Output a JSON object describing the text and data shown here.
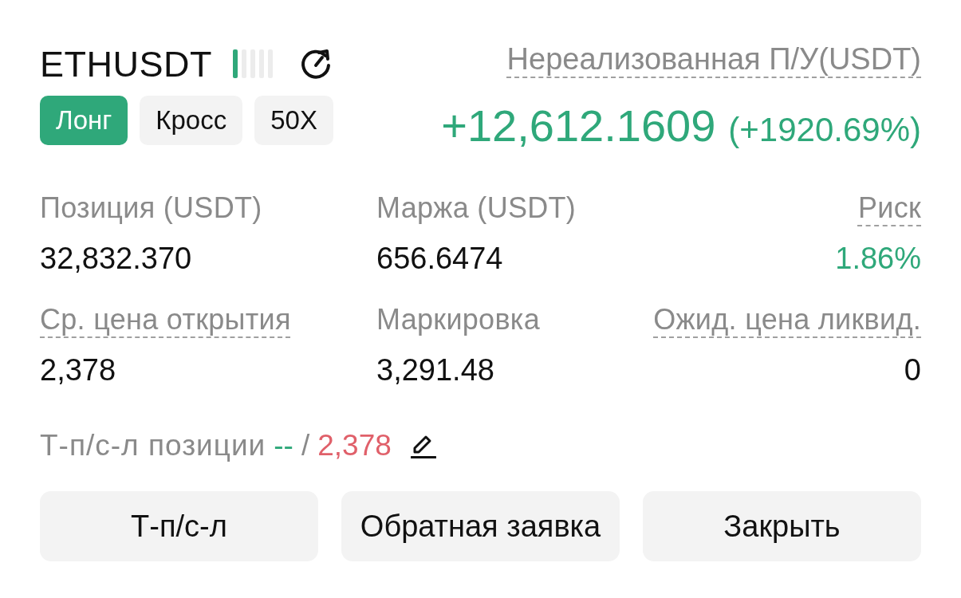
{
  "header": {
    "symbol": "ETHUSDT",
    "risk_meter": {
      "level": 0.2
    },
    "tags": [
      {
        "label": "Лонг",
        "kind": "side"
      },
      {
        "label": "Кросс",
        "kind": "plain"
      },
      {
        "label": "50X",
        "kind": "plain"
      }
    ]
  },
  "pnl": {
    "label": "Нереализованная П/У(USDT)",
    "underlined": true,
    "value": "+12,612.1609",
    "percent": "(+1920.69%)"
  },
  "stats": [
    {
      "label": "Позиция (USDT)",
      "underlined": false,
      "value": "32,832.370",
      "positive": false
    },
    {
      "label": "Маржа (USDT)",
      "underlined": false,
      "value": "656.6474",
      "positive": false
    },
    {
      "label": "Риск",
      "underlined": true,
      "value": "1.86%",
      "positive": true
    },
    {
      "label": "Ср. цена открытия",
      "underlined": true,
      "value": "2,378",
      "positive": false
    },
    {
      "label": "Маркировка",
      "underlined": false,
      "value": "3,291.48",
      "positive": false
    },
    {
      "label": "Ожид. цена ликвид.",
      "underlined": true,
      "value": "0",
      "positive": false
    }
  ],
  "tpsl": {
    "label": "Т-п/с-л позиции",
    "take_profit": "--",
    "separator": "/",
    "stop_loss": "2,378"
  },
  "buttons": [
    "Т-п/с-л",
    "Обратная заявка",
    "Закрыть"
  ]
}
